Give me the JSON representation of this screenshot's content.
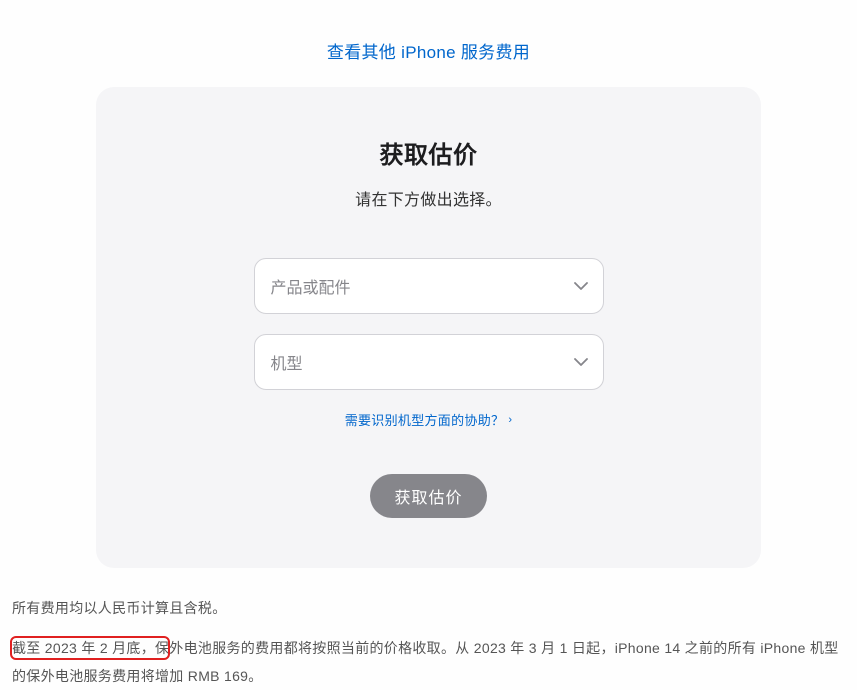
{
  "top_link": {
    "label": "查看其他 iPhone 服务费用"
  },
  "card": {
    "title": "获取估价",
    "subtitle": "请在下方做出选择。",
    "select_product": {
      "placeholder": "产品或配件"
    },
    "select_model": {
      "placeholder": "机型"
    },
    "help_link": {
      "label": "需要识别机型方面的协助？"
    },
    "submit": {
      "label": "获取估价"
    }
  },
  "footer": {
    "note1": "所有费用均以人民币计算且含税。",
    "note2_part1": "截至 2023 年 2 月底，保外电池服务的费用都将按照当前的价格收取。从 2023 年 3 月 1 日起，iPhone 14 之前的所有 iPhone 机型的保外电池服务",
    "note2_highlight": "费用将增加 RMB 169。"
  }
}
